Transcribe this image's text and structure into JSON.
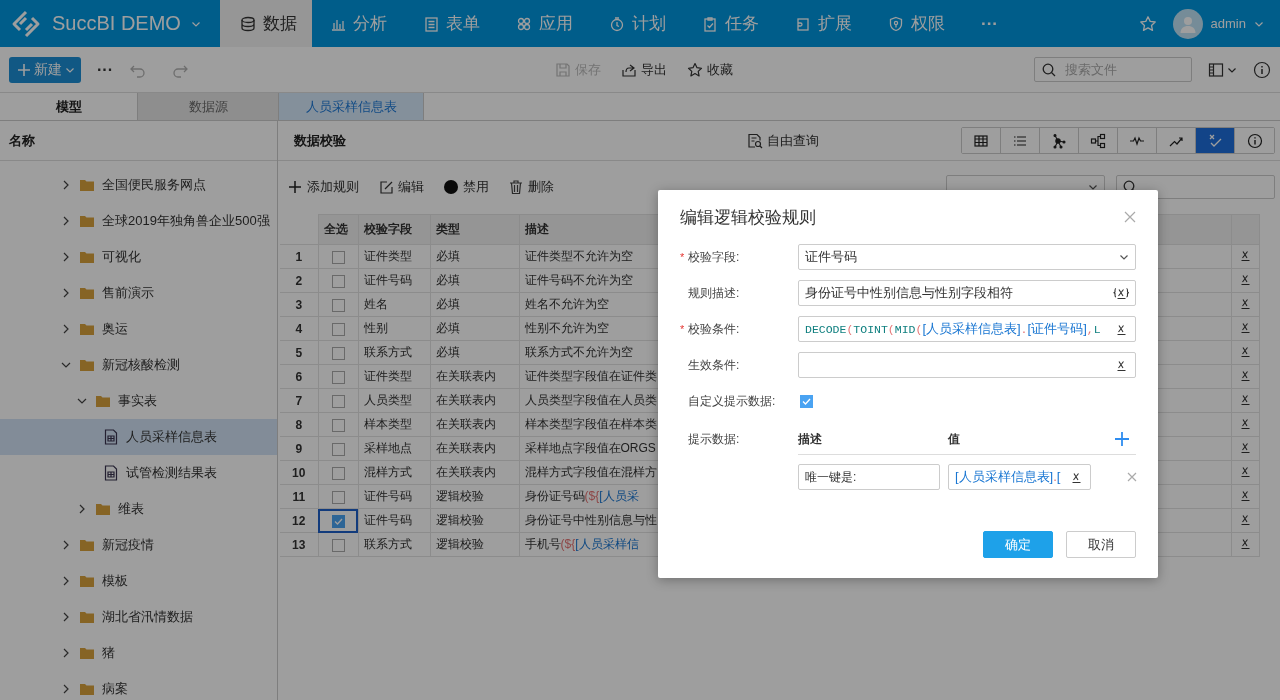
{
  "app": {
    "title": "SuccBI DEMO"
  },
  "nav": [
    {
      "label": "数据",
      "selected": true
    },
    {
      "label": "分析",
      "selected": false
    },
    {
      "label": "表单",
      "selected": false
    },
    {
      "label": "应用",
      "selected": false
    },
    {
      "label": "计划",
      "selected": false
    },
    {
      "label": "任务",
      "selected": false
    },
    {
      "label": "扩展",
      "selected": false
    },
    {
      "label": "权限",
      "selected": false
    }
  ],
  "nav_more": "···",
  "user": {
    "name": "admin"
  },
  "toolbar": {
    "new_button": "新建",
    "more": "···",
    "history": [
      {
        "disabled": true
      },
      {
        "disabled": true
      }
    ],
    "actions": [
      {
        "label": "保存",
        "disabled": true
      },
      {
        "label": "导出",
        "disabled": false
      },
      {
        "label": "收藏",
        "disabled": false
      }
    ],
    "search": {
      "placeholder": "搜索文件"
    }
  },
  "panel_tabs": [
    {
      "label": "模型",
      "selected": true
    },
    {
      "label": "数据源",
      "selected": false
    }
  ],
  "doc_tabs": [
    {
      "label": "人员采样信息表",
      "selected": true
    }
  ],
  "tree": {
    "header": "名称",
    "items": [
      {
        "label": "全国便民服务网点",
        "kind": "folder",
        "expanded": false,
        "selected": false
      },
      {
        "label": "全球2019年独角兽企业500强",
        "kind": "folder",
        "expanded": false,
        "selected": false
      },
      {
        "label": "可视化",
        "kind": "folder",
        "expanded": false,
        "selected": false
      },
      {
        "label": "售前演示",
        "kind": "folder",
        "expanded": false,
        "selected": false
      },
      {
        "label": "奥运",
        "kind": "folder",
        "expanded": false,
        "selected": false
      },
      {
        "label": "新冠核酸检测",
        "kind": "folder",
        "expanded": true,
        "selected": false,
        "children": [
          {
            "label": "事实表",
            "kind": "folder",
            "expanded": true,
            "selected": false,
            "children": [
              {
                "label": "人员采样信息表",
                "kind": "table",
                "selected": true
              },
              {
                "label": "试管检测结果表",
                "kind": "table",
                "selected": false
              }
            ]
          },
          {
            "label": "维表",
            "kind": "folder",
            "expanded": false,
            "selected": false
          }
        ]
      },
      {
        "label": "新冠疫情",
        "kind": "folder",
        "expanded": false,
        "selected": false
      },
      {
        "label": "模板",
        "kind": "folder",
        "expanded": false,
        "selected": false
      },
      {
        "label": "湖北省汛情数据",
        "kind": "folder",
        "expanded": false,
        "selected": false
      },
      {
        "label": "猪",
        "kind": "folder",
        "expanded": false,
        "selected": false
      },
      {
        "label": "病案",
        "kind": "folder",
        "expanded": false,
        "selected": false
      }
    ]
  },
  "section": {
    "title": "数据校验",
    "query_link": "自由查询",
    "views": [
      {
        "selected": false
      },
      {
        "selected": false
      },
      {
        "selected": false
      },
      {
        "selected": false
      },
      {
        "selected": false
      },
      {
        "selected": false
      },
      {
        "selected": true
      },
      {
        "selected": false
      }
    ]
  },
  "rule_toolbar": {
    "actions": [
      {
        "label": "添加规则"
      },
      {
        "label": "编辑"
      },
      {
        "label": "禁用"
      },
      {
        "label": "删除"
      }
    ],
    "filter": {
      "open": false
    }
  },
  "table": {
    "columns": [
      "全选",
      "校验字段",
      "类型",
      "描述"
    ],
    "rows": [
      {
        "index": "1",
        "checked": false,
        "selected": false,
        "field": "证件类型",
        "type": "必填",
        "description": [
          {
            "kind": "text",
            "text": "证件类型不允许为空"
          }
        ]
      },
      {
        "index": "2",
        "checked": false,
        "selected": false,
        "field": "证件号码",
        "type": "必填",
        "description": [
          {
            "kind": "text",
            "text": "证件号码不允许为空"
          }
        ]
      },
      {
        "index": "3",
        "checked": false,
        "selected": false,
        "field": "姓名",
        "type": "必填",
        "description": [
          {
            "kind": "text",
            "text": "姓名不允许为空"
          }
        ]
      },
      {
        "index": "4",
        "checked": false,
        "selected": false,
        "field": "性别",
        "type": "必填",
        "description": [
          {
            "kind": "text",
            "text": "性别不允许为空"
          }
        ]
      },
      {
        "index": "5",
        "checked": false,
        "selected": false,
        "field": "联系方式",
        "type": "必填",
        "description": [
          {
            "kind": "text",
            "text": "联系方式不允许为空"
          }
        ]
      },
      {
        "index": "6",
        "checked": false,
        "selected": false,
        "field": "证件类型",
        "type": "在关联表内",
        "description": [
          {
            "kind": "text",
            "text": "证件类型字段值在证件类"
          }
        ]
      },
      {
        "index": "7",
        "checked": false,
        "selected": false,
        "field": "人员类型",
        "type": "在关联表内",
        "description": [
          {
            "kind": "text",
            "text": "人员类型字段值在人员类"
          }
        ]
      },
      {
        "index": "8",
        "checked": false,
        "selected": false,
        "field": "样本类型",
        "type": "在关联表内",
        "description": [
          {
            "kind": "text",
            "text": "样本类型字段值在样本类"
          }
        ]
      },
      {
        "index": "9",
        "checked": false,
        "selected": false,
        "field": "采样地点",
        "type": "在关联表内",
        "description": [
          {
            "kind": "text",
            "text": "采样地点字段值在ORGS"
          }
        ]
      },
      {
        "index": "10",
        "checked": false,
        "selected": false,
        "field": "混样方式",
        "type": "在关联表内",
        "description": [
          {
            "kind": "text",
            "text": "混样方式字段值在混样方"
          }
        ]
      },
      {
        "index": "11",
        "checked": false,
        "selected": false,
        "field": "证件号码",
        "type": "逻辑校验",
        "description": [
          {
            "kind": "text",
            "text": "身份证号码"
          },
          {
            "kind": "punct",
            "text": "(${"
          },
          {
            "kind": "ref",
            "text": "[人员采"
          }
        ]
      },
      {
        "index": "12",
        "checked": true,
        "selected": true,
        "field": "证件号码",
        "type": "逻辑校验",
        "description": [
          {
            "kind": "text",
            "text": "身份证号中性别信息与性"
          }
        ]
      },
      {
        "index": "13",
        "checked": false,
        "selected": false,
        "field": "联系方式",
        "type": "逻辑校验",
        "description": [
          {
            "kind": "text",
            "text": "手机号"
          },
          {
            "kind": "punct",
            "text": "(${"
          },
          {
            "kind": "ref",
            "text": "[人员采样信"
          }
        ]
      }
    ]
  },
  "dialog": {
    "title": "编辑逻辑校验规则",
    "required_mark": "*",
    "fields": [
      {
        "kind": "select",
        "label": "校验字段:",
        "required": true,
        "value": [
          {
            "kind": "text",
            "text": "证件号码"
          }
        ]
      },
      {
        "kind": "formula",
        "label": "规则描述:",
        "required": false,
        "braces": true,
        "value": [
          {
            "kind": "text",
            "text": "身份证号中性别信息与性别字段相符"
          }
        ]
      },
      {
        "kind": "formula",
        "label": "校验条件:",
        "required": true,
        "braces": false,
        "value": [
          {
            "kind": "func",
            "text": "DECODE"
          },
          {
            "kind": "punct",
            "text": "("
          },
          {
            "kind": "func",
            "text": "TOINT"
          },
          {
            "kind": "punct",
            "text": "("
          },
          {
            "kind": "func",
            "text": "MID"
          },
          {
            "kind": "punct",
            "text": "("
          },
          {
            "kind": "ref",
            "text": "[人员采样信息表]"
          },
          {
            "kind": "punct",
            "text": "."
          },
          {
            "kind": "ref",
            "text": "[证件号码]"
          },
          {
            "kind": "punct",
            "text": ","
          },
          {
            "kind": "func",
            "text": "L"
          }
        ]
      },
      {
        "kind": "formula",
        "label": "生效条件:",
        "required": false,
        "braces": false
      },
      {
        "kind": "checkbox",
        "label": "自定义提示数据:",
        "required": false,
        "checked": true
      },
      {
        "kind": "hints",
        "label": "提示数据:",
        "required": false,
        "columns": [
          "描述",
          "值"
        ],
        "rows": [
          {
            "description": "唯一键是:",
            "value": [
              {
                "kind": "ref",
                "text": "[人员采样信息表]"
              },
              {
                "kind": "punct",
                "text": "."
              },
              {
                "kind": "ref",
                "text": "["
              }
            ]
          }
        ]
      }
    ],
    "buttons": [
      {
        "label": "确定",
        "kind": "primary"
      },
      {
        "label": "取消",
        "kind": "secondary"
      }
    ]
  }
}
